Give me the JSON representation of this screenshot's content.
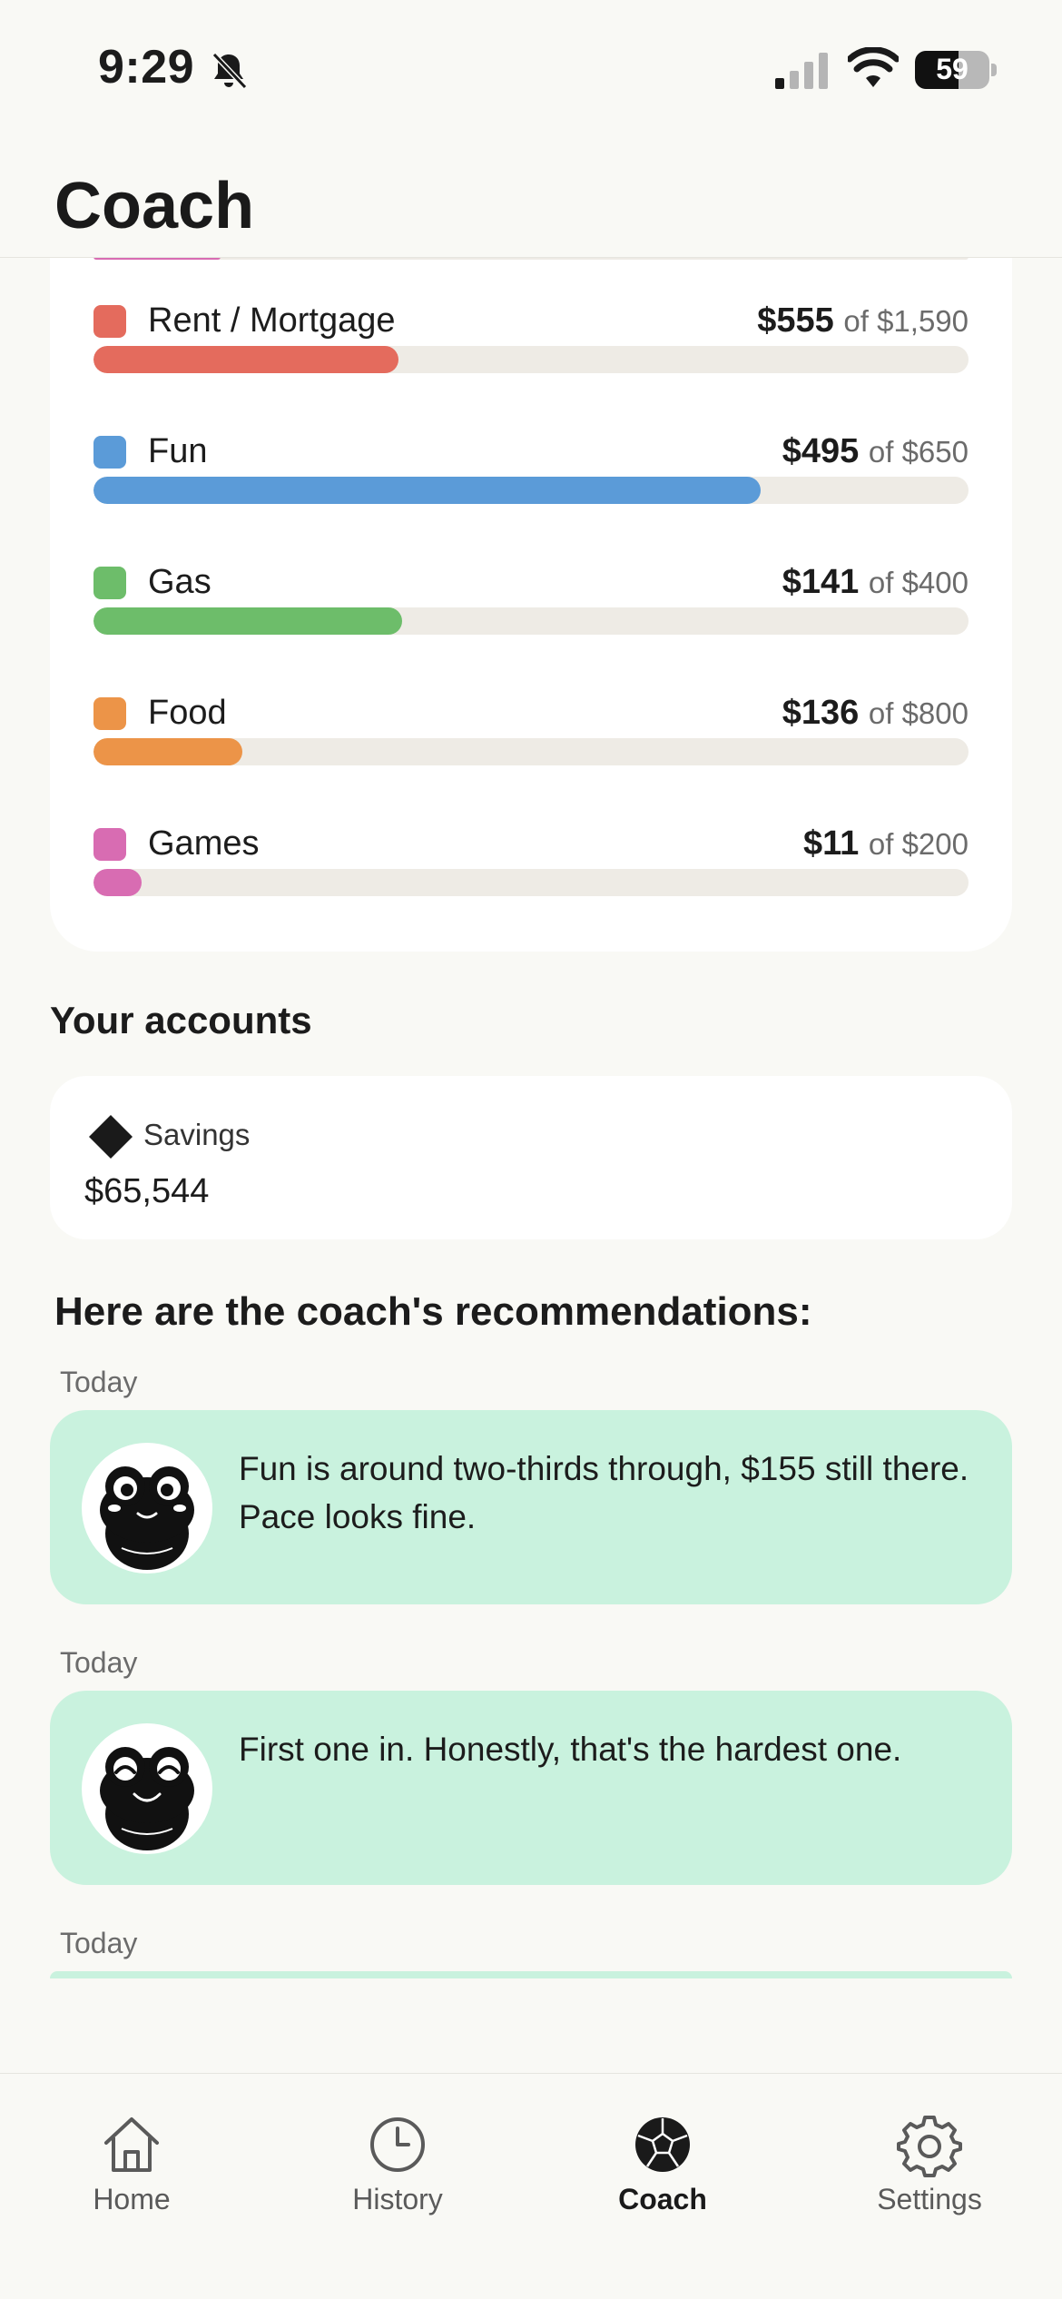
{
  "status_bar": {
    "time": "9:29",
    "battery_level": "59",
    "battery_fraction": 0.59,
    "icons": [
      "bell-slash-icon",
      "signal-icon",
      "wifi-icon",
      "battery-icon"
    ]
  },
  "header": {
    "title": "Coach"
  },
  "budgets": [
    {
      "name": "Rent / Mortgage",
      "spent": "$555",
      "of": "of $1,590",
      "fraction": 0.349,
      "color": "#e46b5d"
    },
    {
      "name": "Fun",
      "spent": "$495",
      "of": "of $650",
      "fraction": 0.762,
      "color": "#5b9bd8"
    },
    {
      "name": "Gas",
      "spent": "$141",
      "of": "of $400",
      "fraction": 0.353,
      "color": "#6dbd6a"
    },
    {
      "name": "Food",
      "spent": "$136",
      "of": "of $800",
      "fraction": 0.17,
      "color": "#ec9448"
    },
    {
      "name": "Games",
      "spent": "$11",
      "of": "of $200",
      "fraction": 0.055,
      "color": "#d86cb2"
    }
  ],
  "accounts": {
    "title": "Your accounts",
    "items": [
      {
        "name": "Savings",
        "balance": "$65,544",
        "icon": "diamond-icon"
      }
    ]
  },
  "recommendations": {
    "title": "Here are the coach's recommendations:",
    "items": [
      {
        "date": "Today",
        "text": "Fun is around two-thirds through, $155 still there. Pace looks fine.",
        "avatar": "frog-avatar-icon"
      },
      {
        "date": "Today",
        "text": "First one in. Honestly, that's the hardest one.",
        "avatar": "frog-avatar-happy-icon"
      },
      {
        "date": "Today"
      }
    ]
  },
  "tabs": [
    {
      "label": "Home",
      "icon": "house-icon"
    },
    {
      "label": "History",
      "icon": "clock-icon"
    },
    {
      "label": "Coach",
      "icon": "coach-ball-icon",
      "active": true
    },
    {
      "label": "Settings",
      "icon": "gear-icon"
    }
  ],
  "colors": {
    "background": "#f9f9f5",
    "card": "#ffffff",
    "recommendation_card": "#c9f2de",
    "track": "#eeebe5"
  }
}
